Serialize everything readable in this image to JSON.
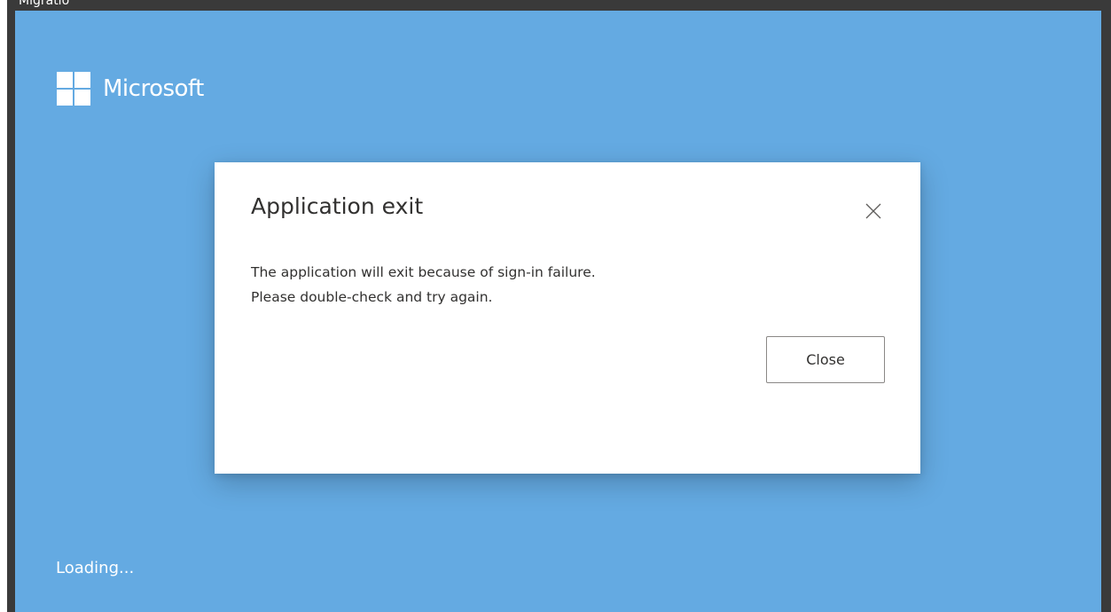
{
  "window": {
    "title": "Migratio"
  },
  "brand": {
    "logo_text": "Microsoft",
    "logo_icon": "microsoft-logo-icon",
    "background_color": "#64aae2"
  },
  "status": {
    "loading_text": "Loading..."
  },
  "dialog": {
    "title": "Application exit",
    "close_icon": "close-icon",
    "message_lines": [
      "The application will exit because of sign-in failure.",
      "Please double-check and try again."
    ],
    "close_button_label": "Close"
  }
}
